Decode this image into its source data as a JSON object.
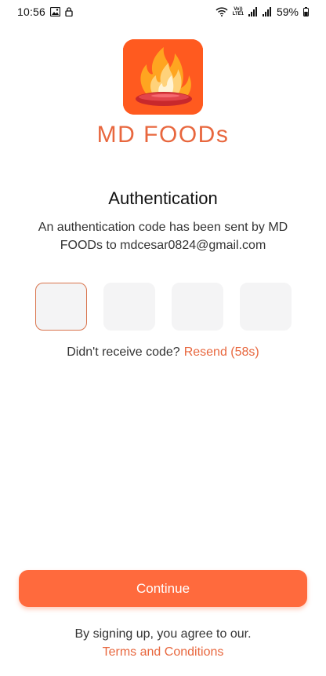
{
  "status_bar": {
    "time": "10:56",
    "network_top": "Vo))",
    "network_bottom": "LTE1",
    "battery": "59%"
  },
  "brand": {
    "name": "MD FOODs",
    "accent_color": "#e8673e",
    "logo_icon": "flaming-plate-icon"
  },
  "auth": {
    "title": "Authentication",
    "description": "An authentication code has been sent by MD FOODs to mdcesar0824@gmail.com"
  },
  "otp": {
    "digits": [
      "",
      "",
      "",
      ""
    ]
  },
  "resend": {
    "prompt": "Didn't receive code?",
    "link": "Resend (58s)"
  },
  "actions": {
    "continue_label": "Continue",
    "continue_color": "#ff6a3d"
  },
  "footer": {
    "note": "By signing up, you agree to our.",
    "terms_link": "Terms and Conditions"
  }
}
